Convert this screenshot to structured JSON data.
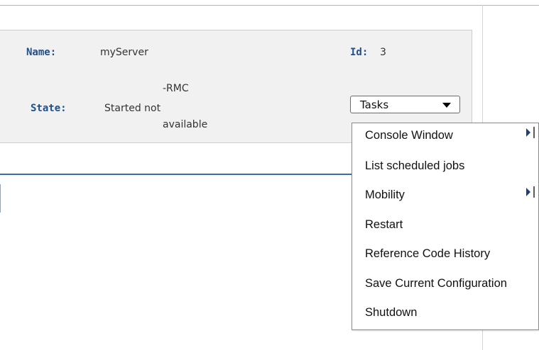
{
  "server": {
    "name_label": "Name:",
    "name_value": "myServer",
    "id_label": "Id:",
    "id_value": "3",
    "state_label": "State:",
    "state_line1": "-RMC",
    "state_line2": "Started not",
    "state_line3": "available"
  },
  "tasks_button": {
    "label": "Tasks"
  },
  "tasks_menu": {
    "items": [
      {
        "label": "Console Window",
        "has_submenu": true
      },
      {
        "label": "List scheduled jobs",
        "has_submenu": false
      },
      {
        "label": "Mobility",
        "has_submenu": true
      },
      {
        "label": "Restart",
        "has_submenu": false
      },
      {
        "label": "Reference Code History",
        "has_submenu": false
      },
      {
        "label": "Save Current Configuration",
        "has_submenu": false
      },
      {
        "label": "Shutdown",
        "has_submenu": false
      }
    ]
  },
  "icons": [
    "dropdown-arrow-icon",
    "submenu-arrow-icon"
  ],
  "colors": {
    "label_blue": "#1f4f8c",
    "divider_blue": "#3a6ca6",
    "panel_bg": "#f1f1f1"
  }
}
